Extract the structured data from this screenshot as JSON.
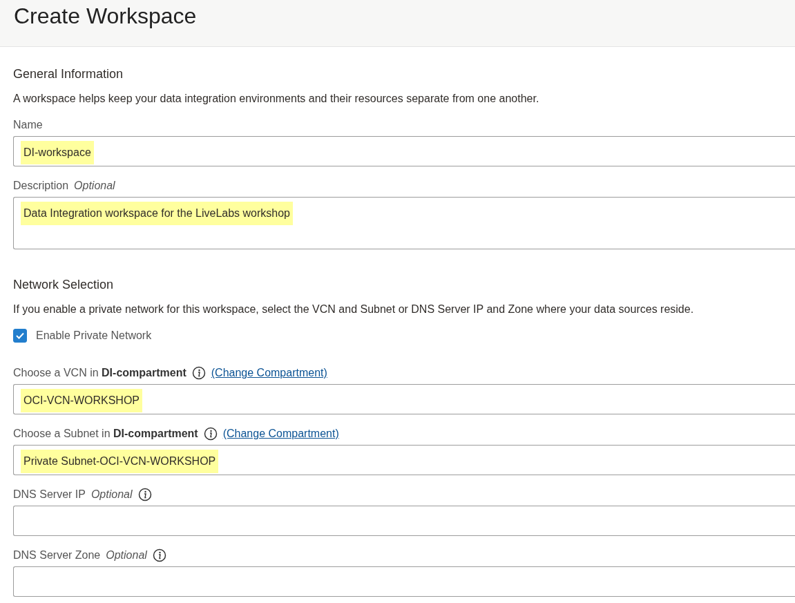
{
  "page": {
    "title": "Create Workspace"
  },
  "sections": [
    {
      "heading": "General Information",
      "description": "A workspace helps keep your data integration environments and their resources separate from one another.",
      "items": [
        {
          "kind": "text",
          "label": "Name",
          "value": "DI-workspace",
          "highlighted": true
        },
        {
          "kind": "textarea",
          "label": "Description",
          "optional": "Optional",
          "value": "Data Integration workspace for the LiveLabs workshop",
          "highlighted": true
        }
      ]
    },
    {
      "heading": "Network Selection",
      "description": "If you enable a private network for this workspace, select the VCN and Subnet or DNS Server IP and Zone where your data sources reside.",
      "items": [
        {
          "kind": "checkbox",
          "label": "Enable Private Network",
          "checked": true
        },
        {
          "kind": "text",
          "label": "Choose a VCN in **DI-compartment**",
          "info": true,
          "link": "(Change Compartment)",
          "value": "OCI-VCN-WORKSHOP",
          "highlighted": true
        },
        {
          "kind": "text",
          "label": "Choose a Subnet in **DI-compartment**",
          "info": true,
          "link": "(Change Compartment)",
          "value": "Private Subnet-OCI-VCN-WORKSHOP",
          "highlighted": true
        },
        {
          "kind": "text",
          "label": "DNS Server IP",
          "optional": "Optional",
          "info": true
        },
        {
          "kind": "text",
          "label": "DNS Server Zone",
          "optional": "Optional",
          "info": true
        }
      ]
    }
  ]
}
